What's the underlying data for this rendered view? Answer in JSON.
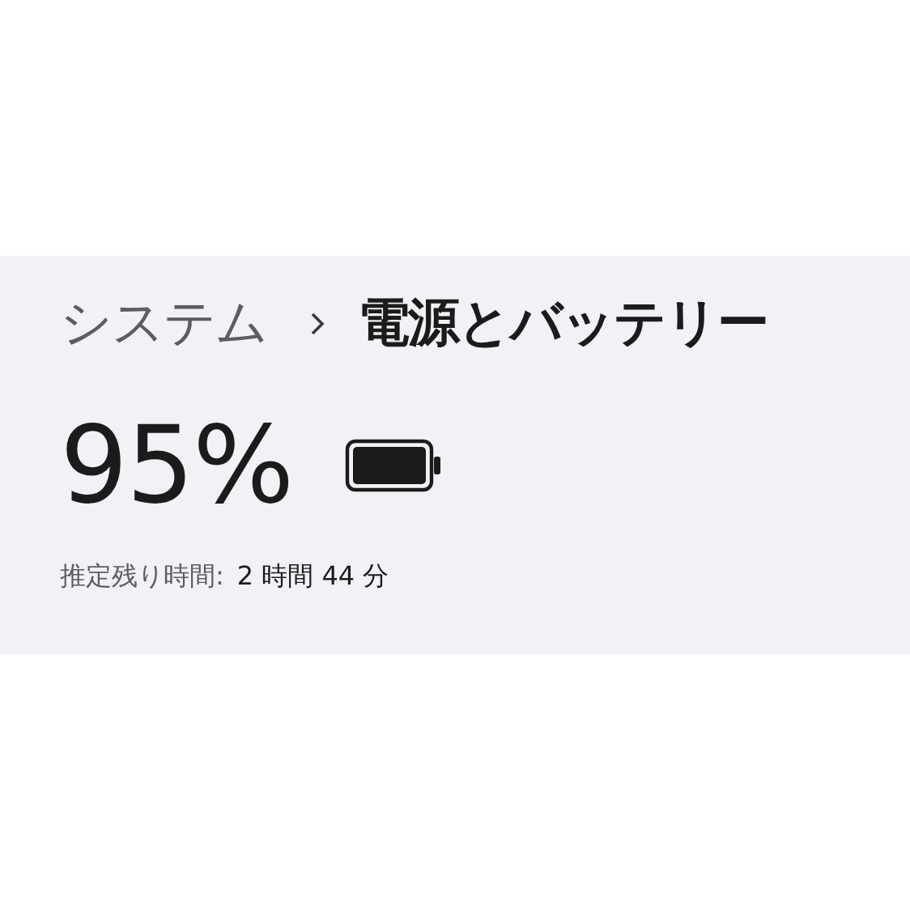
{
  "breadcrumb": {
    "parent": "システム",
    "current": "電源とバッテリー"
  },
  "battery": {
    "percent": "95%"
  },
  "estimate": {
    "label": "推定残り時間:",
    "value": "2 時間 44 分"
  }
}
